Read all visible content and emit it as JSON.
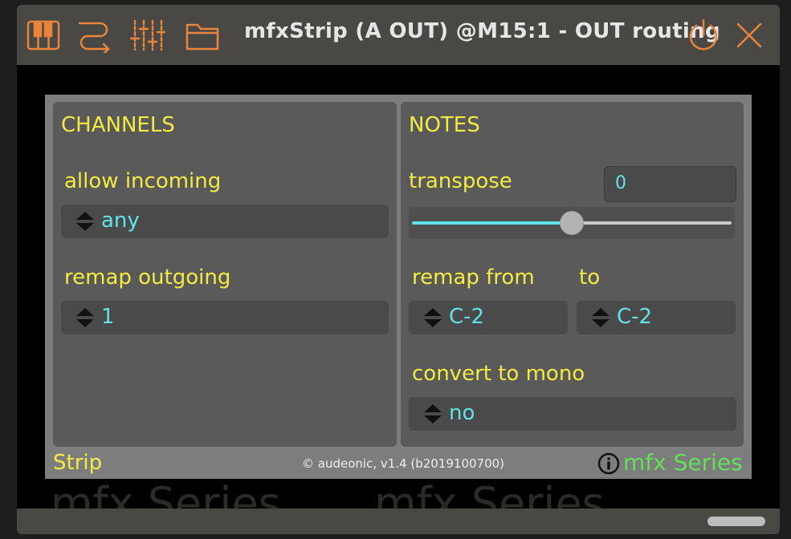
{
  "window": {
    "title": "mfxStrip (A OUT) @M15:1 - OUT routing",
    "accent": "#e8853a",
    "titlebar_color": "#4a4845"
  },
  "toolbar": {
    "icons": [
      "piano-keys-icon",
      "routing-icon",
      "mixer-sliders-icon",
      "folder-icon",
      "power-icon",
      "close-icon"
    ]
  },
  "background": {
    "watermark": "mfx Series"
  },
  "channels": {
    "heading": "CHANNELS",
    "allow_incoming_label": "allow incoming",
    "allow_incoming_value": "any",
    "remap_outgoing_label": "remap outgoing",
    "remap_outgoing_value": "1"
  },
  "notes": {
    "heading": "NOTES",
    "transpose_label": "transpose",
    "transpose_value": "0",
    "transpose_slider_fraction": 0.5,
    "remap_from_label": "remap from",
    "remap_from_value": "C-2",
    "to_label": "to",
    "to_value": "C-2",
    "convert_mono_label": "convert to mono",
    "convert_mono_value": "no"
  },
  "footer": {
    "left": "Strip",
    "middle": "© audeonic, v1.4 (b2019100700)",
    "right": "mfx Series"
  },
  "colors": {
    "label": "#f2ec42",
    "value": "#5fe3ea",
    "brand": "#63e05a"
  }
}
